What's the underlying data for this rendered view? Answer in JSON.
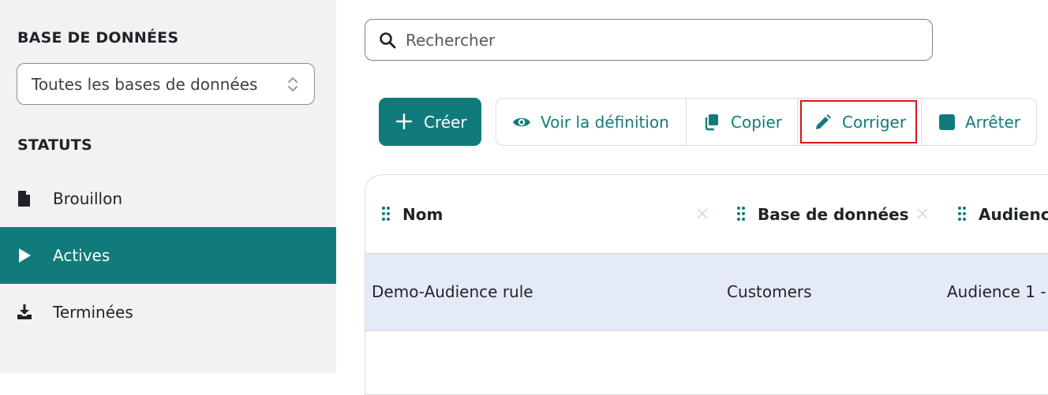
{
  "sidebar": {
    "database_heading": "BASE DE DONNÉES",
    "database_select": "Toutes les bases de données",
    "status_heading": "STATUTS",
    "statuses": [
      {
        "label": "Brouillon",
        "icon": "document-icon",
        "active": false
      },
      {
        "label": "Actives",
        "icon": "play-icon",
        "active": true
      },
      {
        "label": "Terminées",
        "icon": "download-icon",
        "active": false
      }
    ]
  },
  "search": {
    "placeholder": "Rechercher"
  },
  "toolbar": {
    "create_label": "Créer",
    "view_definition_label": "Voir la définition",
    "copy_label": "Copier",
    "edit_label": "Corriger",
    "stop_label": "Arrêter"
  },
  "table": {
    "columns": [
      "Nom",
      "Base de données",
      "Audience"
    ],
    "rows": [
      {
        "name": "Demo-Audience rule",
        "database": "Customers",
        "audience": "Audience 1 -"
      }
    ]
  },
  "colors": {
    "accent": "#117b7b",
    "sidebar_bg": "#f1f2f2",
    "selected_row": "#e4ebf7",
    "highlight": "#d7141a"
  }
}
